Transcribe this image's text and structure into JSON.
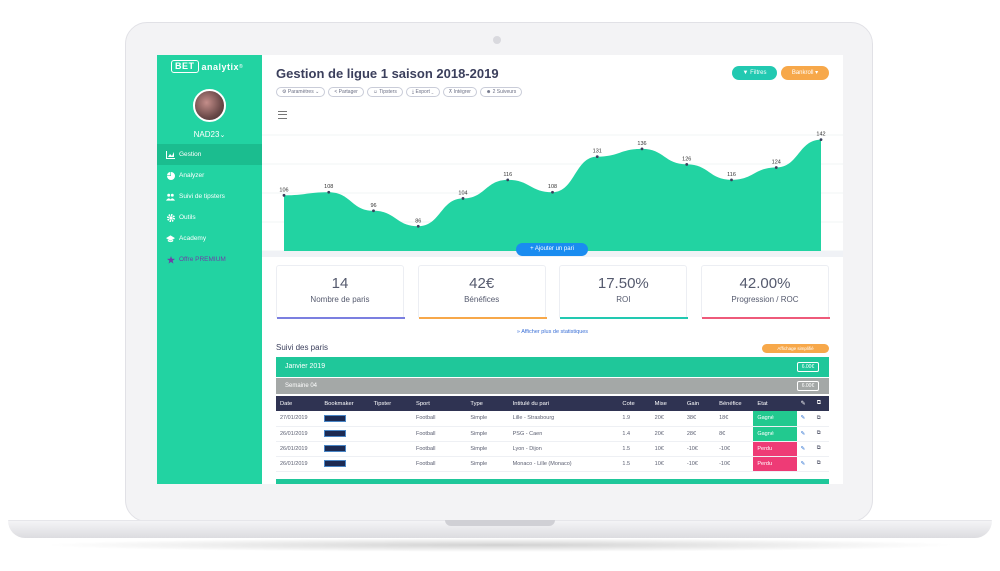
{
  "app": {
    "logo_box": "BET",
    "logo_text": "analytix",
    "logo_mark": "®",
    "username": "NAD23",
    "colors": {
      "accent": "#22d3a2",
      "dark_header": "#2f3352",
      "won": "#22c98f",
      "lost": "#ee3b76",
      "orange": "#f7a84a",
      "blue": "#1a8cf0"
    }
  },
  "sidebar": {
    "items": [
      {
        "label": "Gestion",
        "icon": "chart-area-icon",
        "active": true
      },
      {
        "label": "Analyzer",
        "icon": "pie-chart-icon",
        "active": false
      },
      {
        "label": "Suivi de tipsters",
        "icon": "users-icon",
        "active": false
      },
      {
        "label": "Outils",
        "icon": "cog-icon",
        "active": false
      },
      {
        "label": "Academy",
        "icon": "graduation-cap-icon",
        "active": false
      },
      {
        "label": "Offre PREMIUM",
        "icon": "star-icon",
        "active": false
      }
    ]
  },
  "header": {
    "title": "Gestion de ligue 1 saison 2018-2019",
    "filters_label": "Filtres",
    "bankroll_label": "Bankroll"
  },
  "toolbar": {
    "items": [
      {
        "label": "Paramètres"
      },
      {
        "label": "Partager"
      },
      {
        "label": "Tipsters"
      },
      {
        "label": "Export"
      },
      {
        "label": "Intégrer"
      },
      {
        "label": "2 Suiveurs"
      }
    ]
  },
  "chart_data": {
    "type": "area",
    "values": [
      106,
      108,
      96,
      86,
      104,
      116,
      108,
      131,
      136,
      126,
      116,
      124,
      142
    ],
    "data_labels": [
      "106",
      "108",
      "96",
      "86",
      "104",
      "116",
      "108",
      "131",
      "136",
      "126",
      "116",
      "124",
      "142"
    ],
    "color": "#22d3a2",
    "grid": true
  },
  "add_bet_label": "+ Ajouter un pari",
  "stats": [
    {
      "value": "14",
      "label": "Nombre de paris",
      "color": "#7b7fe0"
    },
    {
      "value": "42€",
      "label": "Bénéfices",
      "color": "#f7a84a"
    },
    {
      "value": "17.50%",
      "label": "ROI",
      "color": "#22c9b1"
    },
    {
      "value": "42.00%",
      "label": "Progression / ROC",
      "color": "#ee5a7a"
    }
  ],
  "more_stats_link": "» Afficher plus de statistiques",
  "section": {
    "title": "Suivi des paris",
    "display_button": "Affichage simplifié"
  },
  "month": {
    "label": "Janvier 2019",
    "badge": "6.00€"
  },
  "week": {
    "label": "Semaine 04",
    "badge": "6.00€"
  },
  "table": {
    "headers": [
      "Date",
      "Bookmaker",
      "Tipster",
      "Sport",
      "Type",
      "Intitulé du pari",
      "Cote",
      "Mise",
      "Gain",
      "Bénéfice",
      "Etat"
    ],
    "rows": [
      {
        "date": "27/01/2019",
        "tipster": "",
        "sport": "Football",
        "type": "Simple",
        "title": "Lille - Strasbourg",
        "odds": "1.9",
        "stake": "20€",
        "gain": "38€",
        "profit": "18€",
        "state": "Gagné",
        "won": true
      },
      {
        "date": "26/01/2019",
        "tipster": "",
        "sport": "Football",
        "type": "Simple",
        "title": "PSG - Caen",
        "odds": "1.4",
        "stake": "20€",
        "gain": "28€",
        "profit": "8€",
        "state": "Gagné",
        "won": true
      },
      {
        "date": "26/01/2019",
        "tipster": "",
        "sport": "Football",
        "type": "Simple",
        "title": "Lyon - Dijon",
        "odds": "1.5",
        "stake": "10€",
        "gain": "-10€",
        "profit": "-10€",
        "state": "Perdu",
        "won": false
      },
      {
        "date": "26/01/2019",
        "tipster": "",
        "sport": "Football",
        "type": "Simple",
        "title": "Monaco - Lille (Monaco)",
        "odds": "1.5",
        "stake": "10€",
        "gain": "-10€",
        "profit": "-10€",
        "state": "Perdu",
        "won": false
      }
    ]
  }
}
